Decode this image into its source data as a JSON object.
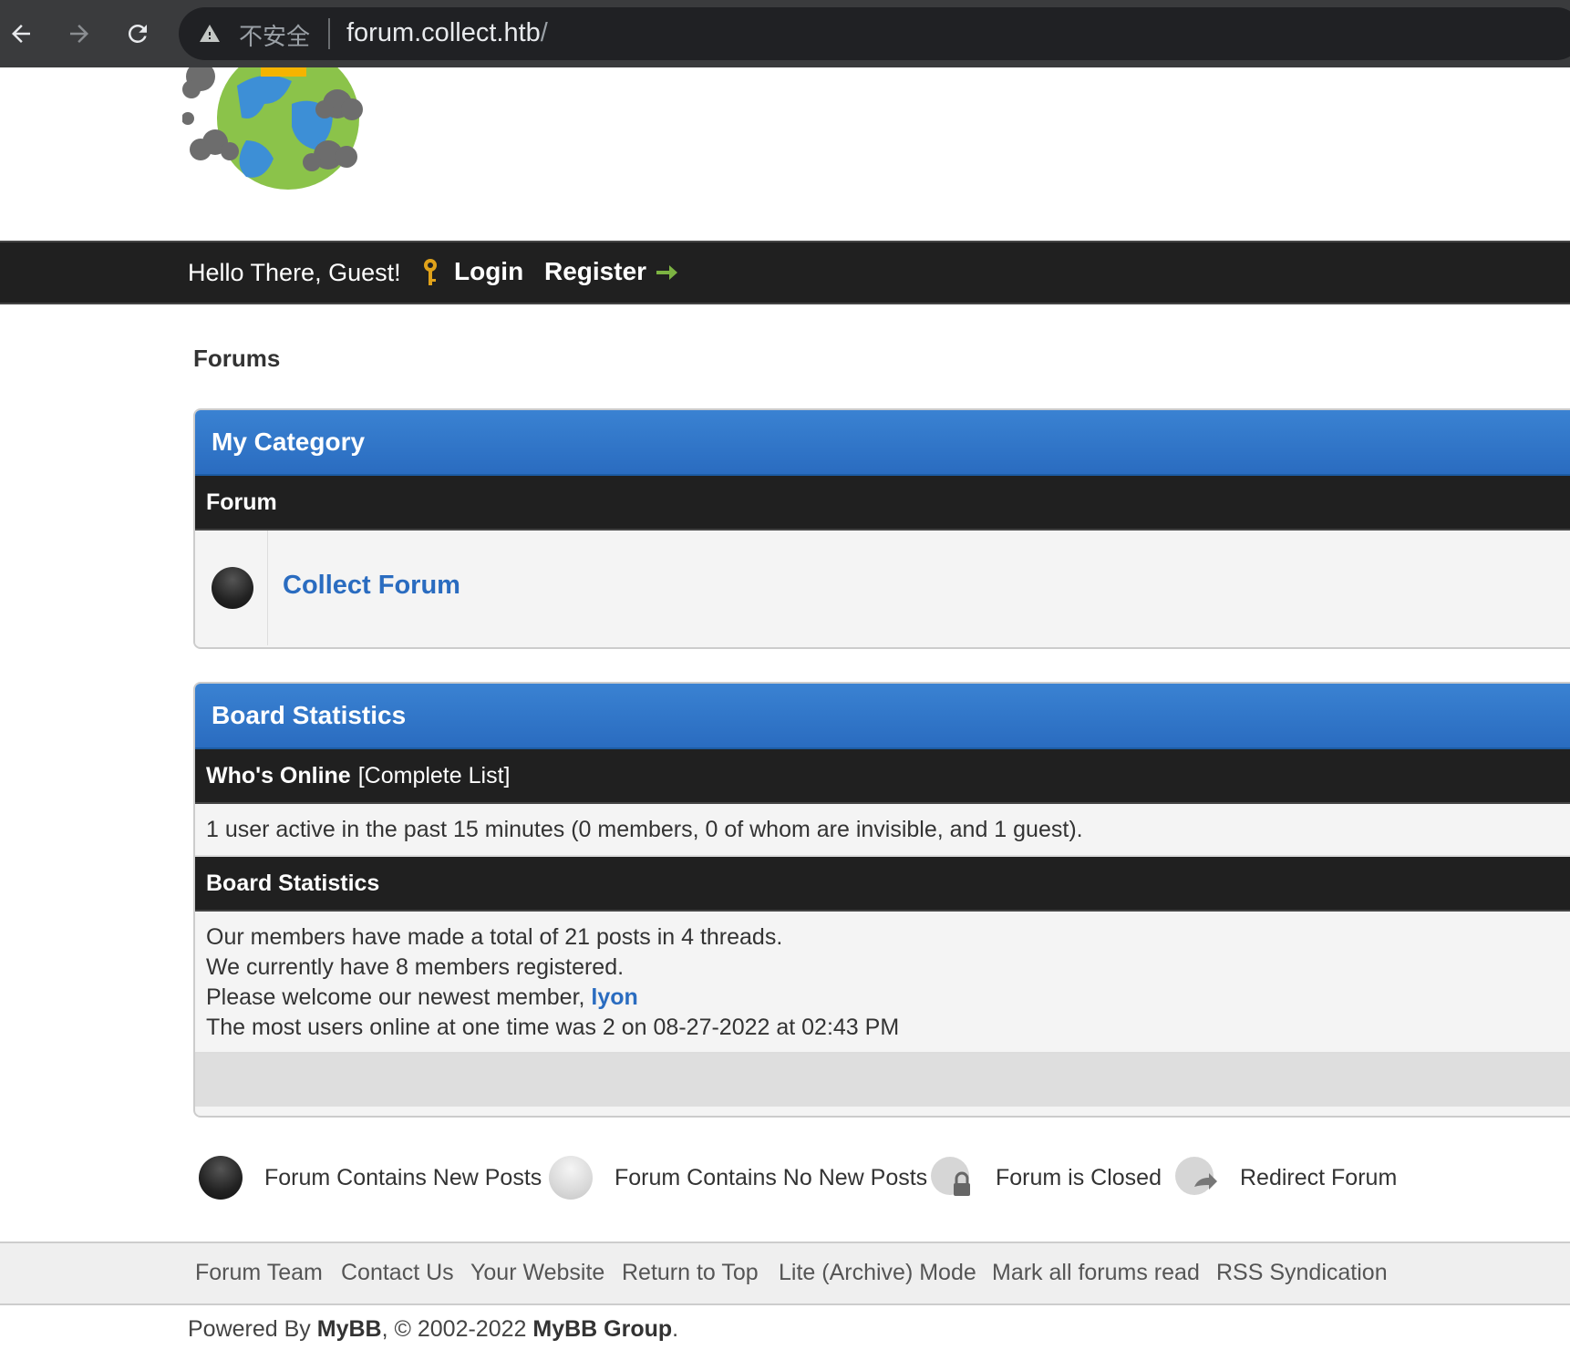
{
  "browser": {
    "not_secure": "不安全",
    "url": "forum.collect.htb",
    "url_slash": "/"
  },
  "userbar": {
    "greeting": "Hello There, Guest!",
    "login": "Login",
    "register": "Register"
  },
  "page_title": "Forums",
  "category": {
    "title": "My Category",
    "column_header": "Forum",
    "forums": [
      {
        "name": "Collect Forum"
      }
    ]
  },
  "board_stats": {
    "title": "Board Statistics",
    "whos_online": "Who's Online",
    "complete_list": "[Complete List]",
    "online_text": "1 user active in the past 15 minutes (0 members, 0 of whom are invisible, and 1 guest).",
    "stats_header": "Board Statistics",
    "line1": "Our members have made a total of 21 posts in 4 threads.",
    "line2": "We currently have 8 members registered.",
    "line3_prefix": "Please welcome our newest member,",
    "newest_member": "lyon",
    "line4": "The most users online at one time was 2 on 08-27-2022 at 02:43 PM"
  },
  "legend": {
    "new_posts": "Forum Contains New Posts",
    "no_new_posts": "Forum Contains No New Posts",
    "closed": "Forum is Closed",
    "redirect": "Redirect Forum"
  },
  "footer_links": {
    "forum_team": "Forum Team",
    "contact_us": "Contact Us",
    "your_website": "Your Website",
    "return_to_top": "Return to Top",
    "lite_mode": "Lite (Archive) Mode",
    "mark_read": "Mark all forums read",
    "rss": "RSS Syndication"
  },
  "copyright": {
    "powered_by": "Powered By",
    "mybb": "MyBB",
    "years": ", © 2002-2022",
    "group": "MyBB Group",
    "end": "."
  },
  "colors": {
    "accent_blue": "#2a6cc0",
    "dark_bar": "#202020"
  }
}
